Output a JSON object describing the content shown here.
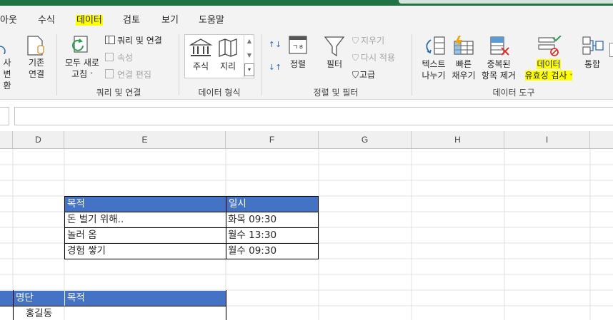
{
  "tabs": {
    "page_layout_partial": "아웃",
    "formulas": "수식",
    "data": "데이터",
    "review": "검토",
    "view": "보기",
    "help": "도움말"
  },
  "ribbon": {
    "get_data": {
      "btn_partial_line1": "사",
      "btn_partial_line2": "변환",
      "existing_conn_line1": "기존",
      "existing_conn_line2": "연결"
    },
    "queries": {
      "refresh_all_line1": "모두 새로",
      "refresh_all_line2": "고침",
      "queries_connections": "쿼리 및 연결",
      "properties": "속성",
      "edit_links": "연결 편집",
      "group_label": "쿼리 및 연결"
    },
    "data_types": {
      "stocks": "주식",
      "geography": "지리",
      "group_label": "데이터 형식"
    },
    "sort_filter": {
      "sort": "정렬",
      "filter": "필터",
      "clear": "지우기",
      "reapply": "다시 적용",
      "advanced": "고급",
      "group_label": "정렬 및 필터"
    },
    "data_tools": {
      "text_to_columns_line1": "텍스트",
      "text_to_columns_line2": "나누기",
      "flash_fill_line1": "빠른",
      "flash_fill_line2": "채우기",
      "remove_dup_line1": "중복된",
      "remove_dup_line2": "항목 제거",
      "validation_line1": "데이터",
      "validation_line2": "유효성 검사",
      "consolidate": "통합",
      "group_label": "데이터 도구"
    }
  },
  "columns": [
    "D",
    "E",
    "F",
    "G",
    "H",
    "I"
  ],
  "table1": {
    "headers": [
      "목적",
      "일시"
    ],
    "rows": [
      [
        "돈 벌기 위해..",
        "화목 09:30"
      ],
      [
        "놀러 옴",
        "월수 13:30"
      ],
      [
        "경험 쌓기",
        "월수 09:30"
      ]
    ]
  },
  "table2": {
    "headers": [
      "명단",
      "목적"
    ],
    "rows": [
      [
        "홍길동",
        ""
      ]
    ]
  },
  "colors": {
    "accent": "#217346",
    "table_header": "#4472c4",
    "highlight": "#ffff00"
  }
}
